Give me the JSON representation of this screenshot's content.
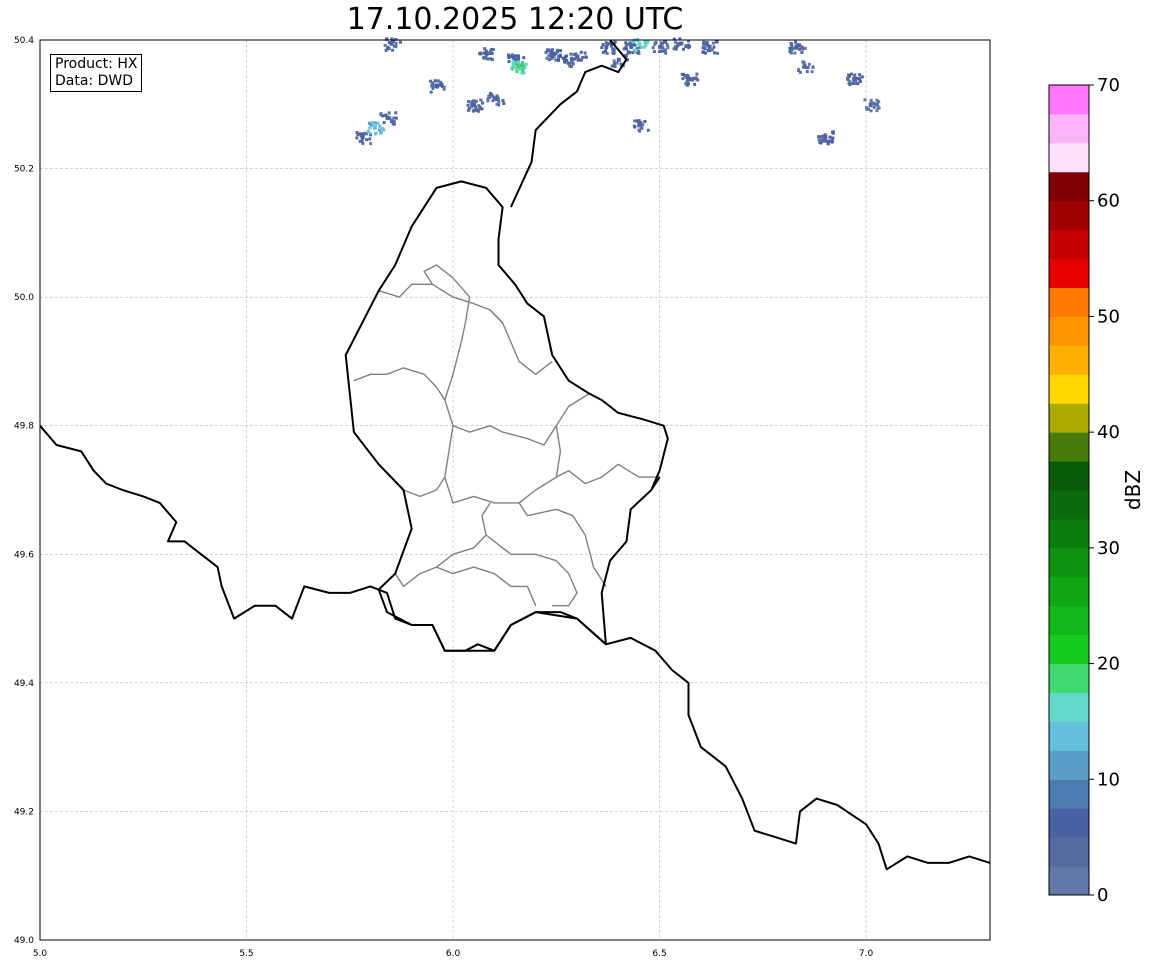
{
  "title": "17.10.2025 12:20 UTC",
  "infobox": {
    "product_line": "Product: HX",
    "data_line": "Data: DWD"
  },
  "chart_data": {
    "type": "heatmap",
    "title": "17.10.2025 12:20 UTC",
    "x_ticks": [
      "5.0",
      "5.5",
      "6.0",
      "6.5",
      "7.0"
    ],
    "y_ticks": [
      "50.4",
      "50.2",
      "50.0",
      "49.8",
      "49.6",
      "49.4",
      "49.2",
      "49.0"
    ],
    "xlim": [
      5.0,
      7.3
    ],
    "ylim": [
      49.0,
      50.4
    ],
    "grid": true,
    "colorbar": {
      "label": "dBZ",
      "ticks": [
        "0",
        "10",
        "20",
        "30",
        "40",
        "50",
        "60",
        "70"
      ],
      "range": [
        0,
        70
      ],
      "step": 2.5,
      "colors": [
        "#6478a8",
        "#566aa2",
        "#4a62a4",
        "#4d7ab0",
        "#5a9fc8",
        "#64c0dc",
        "#62d8c8",
        "#40d870",
        "#14cc1e",
        "#12b81a",
        "#10a616",
        "#0e9212",
        "#0c7e10",
        "#0a6a0c",
        "#065a08",
        "#467a0a",
        "#aaaa00",
        "#ffd800",
        "#ffb000",
        "#ff9400",
        "#ff7800",
        "#e60000",
        "#c40000",
        "#a20000",
        "#7e0000",
        "#ffe0fa",
        "#ffb4fa",
        "#ff78fa",
        "#ee3cee"
      ]
    },
    "echo_cells": [
      {
        "lon": 5.78,
        "lat": 50.25,
        "dbz": 5
      },
      {
        "lon": 5.84,
        "lat": 50.28,
        "dbz": 5
      },
      {
        "lon": 5.81,
        "lat": 50.265,
        "dbz": 14
      },
      {
        "lon": 5.96,
        "lat": 50.33,
        "dbz": 5
      },
      {
        "lon": 6.05,
        "lat": 50.3,
        "dbz": 5
      },
      {
        "lon": 6.1,
        "lat": 50.31,
        "dbz": 5
      },
      {
        "lon": 6.08,
        "lat": 50.38,
        "dbz": 5
      },
      {
        "lon": 6.15,
        "lat": 50.37,
        "dbz": 7
      },
      {
        "lon": 6.155,
        "lat": 50.36,
        "dbz": 18
      },
      {
        "lon": 6.24,
        "lat": 50.38,
        "dbz": 5
      },
      {
        "lon": 6.27,
        "lat": 50.37,
        "dbz": 7
      },
      {
        "lon": 6.3,
        "lat": 50.375,
        "dbz": 5
      },
      {
        "lon": 6.37,
        "lat": 50.39,
        "dbz": 7
      },
      {
        "lon": 6.4,
        "lat": 50.37,
        "dbz": 5
      },
      {
        "lon": 6.43,
        "lat": 50.39,
        "dbz": 5
      },
      {
        "lon": 6.45,
        "lat": 50.395,
        "dbz": 17
      },
      {
        "lon": 6.5,
        "lat": 50.39,
        "dbz": 5
      },
      {
        "lon": 6.55,
        "lat": 50.395,
        "dbz": 5
      },
      {
        "lon": 6.62,
        "lat": 50.39,
        "dbz": 7
      },
      {
        "lon": 6.57,
        "lat": 50.34,
        "dbz": 5
      },
      {
        "lon": 6.45,
        "lat": 50.27,
        "dbz": 5
      },
      {
        "lon": 6.83,
        "lat": 50.39,
        "dbz": 5
      },
      {
        "lon": 6.85,
        "lat": 50.36,
        "dbz": 3
      },
      {
        "lon": 6.97,
        "lat": 50.34,
        "dbz": 5
      },
      {
        "lon": 6.9,
        "lat": 50.25,
        "dbz": 5
      },
      {
        "lon": 7.01,
        "lat": 50.3,
        "dbz": 3
      },
      {
        "lon": 5.85,
        "lat": 50.395,
        "dbz": 5
      }
    ],
    "country_borders": [
      [
        [
          5.0,
          49.8
        ],
        [
          5.04,
          49.77
        ],
        [
          5.1,
          49.76
        ],
        [
          5.13,
          49.73
        ],
        [
          5.16,
          49.71
        ],
        [
          5.2,
          49.7
        ],
        [
          5.25,
          49.69
        ],
        [
          5.29,
          49.68
        ],
        [
          5.33,
          49.65
        ],
        [
          5.31,
          49.62
        ],
        [
          5.35,
          49.62
        ],
        [
          5.39,
          49.6
        ],
        [
          5.43,
          49.58
        ],
        [
          5.44,
          49.55
        ],
        [
          5.47,
          49.5
        ],
        [
          5.52,
          49.52
        ],
        [
          5.57,
          49.52
        ],
        [
          5.61,
          49.5
        ],
        [
          5.64,
          49.55
        ],
        [
          5.7,
          49.54
        ],
        [
          5.75,
          49.54
        ],
        [
          5.8,
          49.55
        ],
        [
          5.84,
          49.54
        ],
        [
          5.86,
          49.5
        ],
        [
          5.9,
          49.49
        ],
        [
          5.95,
          49.49
        ],
        [
          5.98,
          49.45
        ],
        [
          6.03,
          49.45
        ],
        [
          6.06,
          49.46
        ],
        [
          6.1,
          49.45
        ],
        [
          6.14,
          49.49
        ],
        [
          6.2,
          49.51
        ],
        [
          6.26,
          49.51
        ],
        [
          6.3,
          49.5
        ],
        [
          6.37,
          49.46
        ],
        [
          6.43,
          49.47
        ],
        [
          6.49,
          49.45
        ],
        [
          6.53,
          49.42
        ],
        [
          6.57,
          49.4
        ],
        [
          6.57,
          49.35
        ],
        [
          6.6,
          49.3
        ],
        [
          6.66,
          49.27
        ],
        [
          6.7,
          49.22
        ],
        [
          6.73,
          49.17
        ],
        [
          6.78,
          49.16
        ],
        [
          6.83,
          49.15
        ],
        [
          6.84,
          49.2
        ],
        [
          6.88,
          49.22
        ],
        [
          6.93,
          49.21
        ],
        [
          7.0,
          49.18
        ],
        [
          7.03,
          49.15
        ],
        [
          7.05,
          49.11
        ],
        [
          7.1,
          49.13
        ],
        [
          7.15,
          49.12
        ],
        [
          7.2,
          49.12
        ],
        [
          7.25,
          49.13
        ],
        [
          7.3,
          49.12
        ]
      ],
      [
        [
          6.5,
          49.72
        ],
        [
          6.48,
          49.7
        ],
        [
          6.43,
          49.67
        ],
        [
          6.42,
          49.62
        ],
        [
          6.38,
          49.59
        ],
        [
          6.36,
          49.54
        ],
        [
          6.37,
          49.46
        ]
      ],
      [
        [
          6.37,
          49.46
        ],
        [
          6.3,
          49.5
        ],
        [
          6.2,
          49.51
        ],
        [
          6.14,
          49.49
        ],
        [
          6.1,
          49.45
        ],
        [
          6.03,
          49.45
        ],
        [
          5.98,
          49.45
        ],
        [
          5.95,
          49.49
        ],
        [
          5.9,
          49.49
        ],
        [
          5.84,
          49.51
        ],
        [
          5.82,
          49.545
        ],
        [
          5.86,
          49.57
        ],
        [
          5.9,
          49.64
        ],
        [
          5.88,
          49.7
        ],
        [
          5.82,
          49.74
        ],
        [
          5.76,
          49.79
        ],
        [
          5.75,
          49.85
        ],
        [
          5.74,
          49.91
        ],
        [
          5.78,
          49.96
        ],
        [
          5.82,
          50.01
        ],
        [
          5.86,
          50.05
        ],
        [
          5.9,
          50.11
        ],
        [
          5.96,
          50.17
        ],
        [
          6.02,
          50.18
        ],
        [
          6.08,
          50.17
        ],
        [
          6.12,
          50.14
        ],
        [
          6.11,
          50.09
        ],
        [
          6.11,
          50.05
        ],
        [
          6.15,
          50.02
        ],
        [
          6.18,
          49.99
        ],
        [
          6.22,
          49.97
        ],
        [
          6.24,
          49.91
        ],
        [
          6.28,
          49.87
        ],
        [
          6.33,
          49.85
        ],
        [
          6.36,
          49.84
        ],
        [
          6.4,
          49.82
        ],
        [
          6.46,
          49.81
        ],
        [
          6.51,
          49.8
        ],
        [
          6.52,
          49.78
        ],
        [
          6.5,
          49.73
        ],
        [
          6.48,
          49.7
        ]
      ],
      [
        [
          6.14,
          50.14
        ],
        [
          6.19,
          50.21
        ],
        [
          6.2,
          50.26
        ],
        [
          6.26,
          50.3
        ],
        [
          6.3,
          50.32
        ],
        [
          6.32,
          50.35
        ],
        [
          6.36,
          50.36
        ],
        [
          6.4,
          50.35
        ],
        [
          6.42,
          50.37
        ],
        [
          6.38,
          50.4
        ]
      ]
    ],
    "district_borders": [
      [
        [
          5.82,
          50.01
        ],
        [
          5.87,
          50.0
        ],
        [
          5.9,
          50.02
        ],
        [
          5.95,
          50.02
        ],
        [
          6.0,
          50.0
        ],
        [
          6.05,
          49.99
        ],
        [
          6.09,
          49.98
        ],
        [
          6.12,
          49.96
        ]
      ],
      [
        [
          5.95,
          50.02
        ],
        [
          5.93,
          50.04
        ],
        [
          5.96,
          50.05
        ],
        [
          6.0,
          50.03
        ],
        [
          6.04,
          50.0
        ]
      ],
      [
        [
          6.04,
          50.0
        ],
        [
          6.03,
          49.96
        ],
        [
          6.02,
          49.93
        ],
        [
          6.0,
          49.88
        ],
        [
          5.98,
          49.84
        ],
        [
          6.0,
          49.8
        ],
        [
          6.04,
          49.79
        ],
        [
          6.09,
          49.8
        ],
        [
          6.12,
          49.79
        ],
        [
          6.18,
          49.78
        ],
        [
          6.22,
          49.77
        ],
        [
          6.25,
          49.8
        ],
        [
          6.28,
          49.83
        ],
        [
          6.33,
          49.85
        ]
      ],
      [
        [
          5.76,
          49.87
        ],
        [
          5.8,
          49.88
        ],
        [
          5.84,
          49.88
        ],
        [
          5.88,
          49.89
        ],
        [
          5.93,
          49.88
        ],
        [
          5.96,
          49.86
        ],
        [
          5.98,
          49.84
        ]
      ],
      [
        [
          6.09,
          49.98
        ],
        [
          6.12,
          49.96
        ],
        [
          6.14,
          49.93
        ],
        [
          6.16,
          49.9
        ],
        [
          6.2,
          49.88
        ],
        [
          6.24,
          49.9
        ]
      ],
      [
        [
          6.0,
          49.8
        ],
        [
          5.99,
          49.76
        ],
        [
          5.98,
          49.72
        ],
        [
          5.96,
          49.7
        ],
        [
          5.92,
          49.69
        ],
        [
          5.88,
          49.7
        ]
      ],
      [
        [
          5.98,
          49.72
        ],
        [
          6.0,
          49.68
        ],
        [
          6.05,
          49.69
        ],
        [
          6.1,
          49.68
        ],
        [
          6.16,
          49.68
        ],
        [
          6.2,
          49.7
        ],
        [
          6.25,
          49.72
        ],
        [
          6.28,
          49.73
        ],
        [
          6.32,
          49.71
        ],
        [
          6.36,
          49.72
        ],
        [
          6.4,
          49.74
        ],
        [
          6.45,
          49.72
        ],
        [
          6.5,
          49.72
        ]
      ],
      [
        [
          6.25,
          49.8
        ],
        [
          6.26,
          49.76
        ],
        [
          6.25,
          49.72
        ]
      ],
      [
        [
          6.09,
          49.68
        ],
        [
          6.07,
          49.66
        ],
        [
          6.08,
          49.63
        ],
        [
          6.05,
          49.61
        ],
        [
          6.0,
          49.6
        ],
        [
          5.96,
          49.58
        ],
        [
          5.92,
          49.57
        ],
        [
          5.88,
          49.55
        ],
        [
          5.86,
          49.57
        ]
      ],
      [
        [
          6.16,
          49.68
        ],
        [
          6.18,
          49.66
        ],
        [
          6.25,
          49.67
        ],
        [
          6.29,
          49.66
        ],
        [
          6.32,
          49.63
        ],
        [
          6.34,
          49.58
        ],
        [
          6.37,
          49.55
        ]
      ],
      [
        [
          6.08,
          49.63
        ],
        [
          6.1,
          49.62
        ],
        [
          6.14,
          49.6
        ],
        [
          6.2,
          49.6
        ],
        [
          6.25,
          49.59
        ],
        [
          6.28,
          49.57
        ],
        [
          6.3,
          49.54
        ],
        [
          6.28,
          49.52
        ],
        [
          6.24,
          49.52
        ]
      ],
      [
        [
          6.1,
          49.57
        ],
        [
          6.14,
          49.55
        ],
        [
          6.18,
          49.55
        ],
        [
          6.2,
          49.52
        ]
      ],
      [
        [
          5.96,
          49.58
        ],
        [
          6.0,
          49.57
        ],
        [
          6.05,
          49.58
        ],
        [
          6.1,
          49.57
        ]
      ]
    ]
  }
}
